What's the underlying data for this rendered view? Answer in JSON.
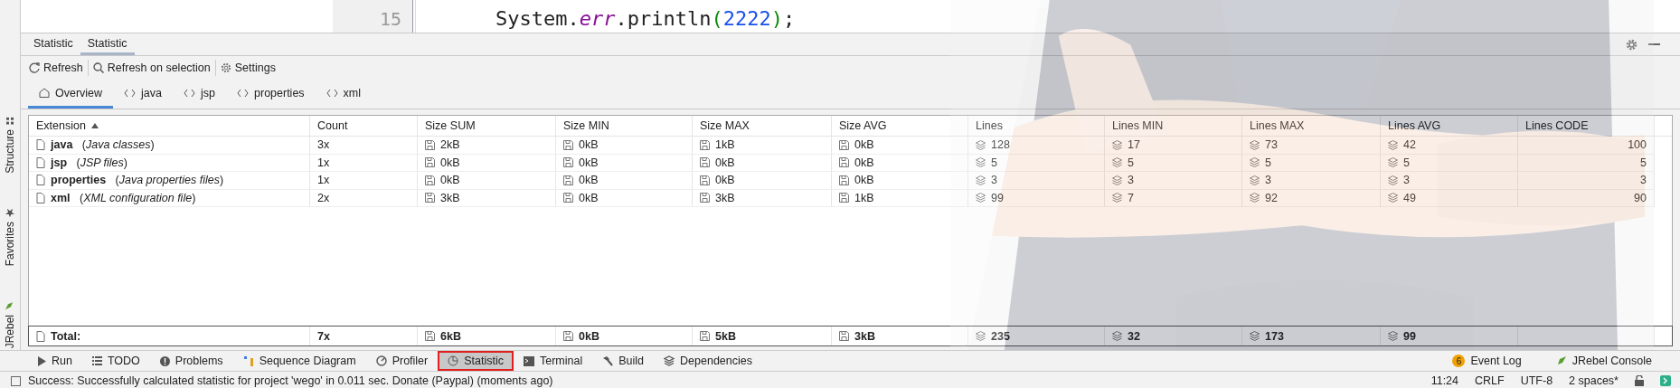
{
  "side_tabs": [
    "Structure",
    "Favorites",
    "JRebel"
  ],
  "editor": {
    "line_numbers": [
      "15"
    ],
    "code_lines": [
      {
        "tokens": [
          {
            "text": "System.",
            "kind": "plain"
          },
          {
            "text": "err",
            "kind": "field"
          },
          {
            "text": ".println",
            "kind": "plain"
          },
          {
            "text": "(",
            "kind": "paren"
          },
          {
            "text": "2222",
            "kind": "number"
          },
          {
            "text": ")",
            "kind": "paren"
          },
          {
            "text": ";",
            "kind": "plain"
          }
        ]
      }
    ]
  },
  "tool_window": {
    "tabs": [
      {
        "label": "Statistic",
        "selected": false
      },
      {
        "label": "Statistic",
        "selected": true
      }
    ],
    "toolbar": [
      "Refresh",
      "Refresh on selection",
      "Settings"
    ],
    "subtabs": [
      {
        "label": "Overview",
        "selected": true
      },
      {
        "label": "java",
        "selected": false
      },
      {
        "label": "jsp",
        "selected": false
      },
      {
        "label": "properties",
        "selected": false
      },
      {
        "label": "xml",
        "selected": false
      }
    ]
  },
  "table": {
    "columns": [
      {
        "label": "Extension",
        "kind": "extension",
        "sorted": true
      },
      {
        "label": "Count",
        "kind": "text",
        "sorted": false
      },
      {
        "label": "Size SUM",
        "kind": "size",
        "sorted": false
      },
      {
        "label": "Size MIN",
        "kind": "size",
        "sorted": false
      },
      {
        "label": "Size MAX",
        "kind": "size",
        "sorted": false
      },
      {
        "label": "Size AVG",
        "kind": "size",
        "sorted": false
      },
      {
        "label": "Lines",
        "kind": "lines",
        "sorted": false
      },
      {
        "label": "Lines MIN",
        "kind": "lines",
        "sorted": false
      },
      {
        "label": "Lines MAX",
        "kind": "lines",
        "sorted": false
      },
      {
        "label": "Lines AVG",
        "kind": "lines",
        "sorted": false
      },
      {
        "label": "Lines CODE",
        "kind": "number",
        "sorted": false
      }
    ],
    "rows": [
      {
        "cells": [
          "**java**   (*Java classes*)",
          "3x",
          "2kB",
          "0kB",
          "1kB",
          "0kB",
          "128",
          "17",
          "73",
          "42",
          "100"
        ]
      },
      {
        "cells": [
          "**jsp**   (*JSP files*)",
          "1x",
          "0kB",
          "0kB",
          "0kB",
          "0kB",
          "5",
          "5",
          "5",
          "5",
          "5"
        ]
      },
      {
        "cells": [
          "**properties**   (*Java properties files*)",
          "1x",
          "0kB",
          "0kB",
          "0kB",
          "0kB",
          "3",
          "3",
          "3",
          "3",
          "3"
        ]
      },
      {
        "cells": [
          "**xml**   (*XML configuration file*)",
          "2x",
          "3kB",
          "0kB",
          "3kB",
          "1kB",
          "99",
          "7",
          "92",
          "49",
          "90"
        ]
      }
    ],
    "total": {
      "cells": [
        "Total:",
        "7x",
        "6kB",
        "0kB",
        "5kB",
        "3kB",
        "235",
        "32",
        "173",
        "99"
      ]
    }
  },
  "bottom_tools": [
    {
      "label": "Run",
      "selected": false
    },
    {
      "label": "TODO",
      "selected": false
    },
    {
      "label": "Problems",
      "selected": false
    },
    {
      "label": "Sequence Diagram",
      "selected": false
    },
    {
      "label": "Profiler",
      "selected": false
    },
    {
      "label": "Statistic",
      "selected": true
    },
    {
      "label": "Terminal",
      "selected": false
    },
    {
      "label": "Build",
      "selected": false
    },
    {
      "label": "Dependencies",
      "selected": false
    }
  ],
  "event_log": {
    "label": "Event Log",
    "badge": "6"
  },
  "jrebel_console": "JRebel Console",
  "status_bar": {
    "message": "Success: Successfully calculated statistic for project 'wego' in 0.011 sec. Donate (Paypal) (moments ago)",
    "items": [
      "11:24",
      "CRLF",
      "UTF-8",
      "2 spaces*"
    ]
  }
}
